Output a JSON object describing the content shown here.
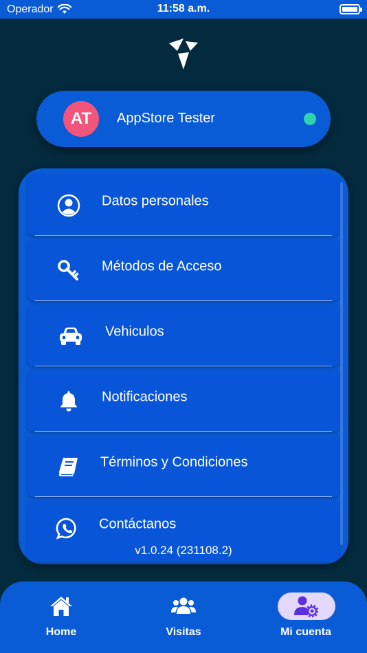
{
  "status_bar": {
    "carrier": "Operador",
    "time": "11:58 a.m."
  },
  "profile": {
    "initials": "AT",
    "name": "AppStore Tester",
    "avatar_color": "#f2557b",
    "online_color": "#2ed3ad"
  },
  "menu": {
    "items": [
      {
        "label": "Datos personales",
        "icon": "user-circle-icon"
      },
      {
        "label": "Métodos de Acceso",
        "icon": "key-icon"
      },
      {
        "label": "Vehiculos",
        "icon": "car-icon"
      },
      {
        "label": "Notificaciones",
        "icon": "bell-icon"
      },
      {
        "label": "Términos y Condiciones",
        "icon": "book-icon"
      },
      {
        "label": "Contáctanos",
        "icon": "whatsapp-icon"
      }
    ],
    "version": "v1.0.24 (231108.2)"
  },
  "tab_bar": {
    "tabs": [
      {
        "label": "Home",
        "icon": "home-icon"
      },
      {
        "label": "Visitas",
        "icon": "users-icon"
      },
      {
        "label": "Mi cuenta",
        "icon": "user-gear-icon",
        "active": true
      }
    ]
  },
  "colors": {
    "background": "#042a3d",
    "primary": "#0a5bd6",
    "active_tab_pill": "#e3d8ff",
    "active_tab_icon": "#5b2ee0"
  }
}
